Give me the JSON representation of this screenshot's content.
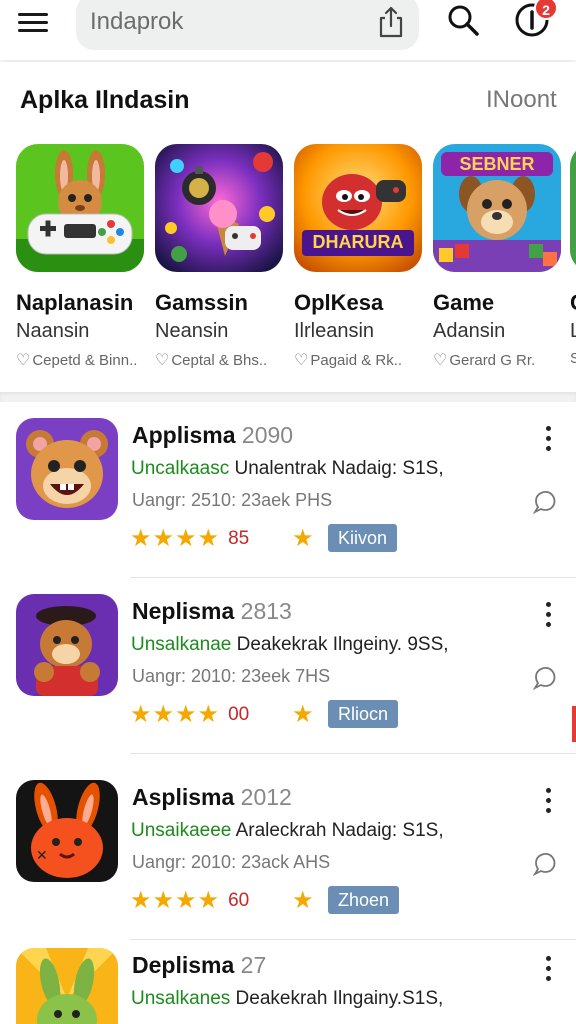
{
  "search": {
    "placeholder": "Indaprok"
  },
  "notifications": {
    "count": "2"
  },
  "featured": {
    "title": "Aplka Ilndasin",
    "more_label": "INoont",
    "cards": [
      {
        "title": "Naplanasin",
        "subtitle": "Naansin",
        "meta": "Cepetd & Binn..",
        "icon": "rabbit-controller-icon"
      },
      {
        "title": "Gamssin",
        "subtitle": "Neansin",
        "meta": "Ceptal & Bhs..",
        "icon": "bomb-ice-cream-icon"
      },
      {
        "title": "OplKesa",
        "subtitle": "Ilrleansin",
        "meta": "Pagaid & Rk..",
        "icon": "red-monster-icon",
        "art_text": "DHARURA"
      },
      {
        "title": "Game",
        "subtitle": "Adansin",
        "meta": "Gerard G Rr.",
        "icon": "puppy-puzzle-icon",
        "art_text": "SEBNER"
      },
      {
        "title": "C",
        "subtitle": "L",
        "meta": "S",
        "icon": "partial-card-icon"
      }
    ]
  },
  "apps": [
    {
      "title": "Applisma",
      "version": "2090",
      "line2_green": "Uncalkaasc",
      "line2_rest": " Unalentrak Nadaig: S1S,",
      "line3": "Uangr: 2510: 23aek  PHS",
      "rating": "85",
      "tag": "Kiivon",
      "icon": "hamster-icon"
    },
    {
      "title": "Neplisma",
      "version": "2813",
      "line2_green": "Unsalkanae",
      "line2_rest": " Deakekrak Ilngeiny. 9SS,",
      "line3": "Uangr: 2010: 23eek  7HS",
      "rating": "00",
      "tag": "Rliocn",
      "icon": "bear-character-icon"
    },
    {
      "title": "Asplisma",
      "version": "2012",
      "line2_green": "Unsaikaeee",
      "line2_rest": " Araleckrah Nadaig: S1S,",
      "line3": "Uangr: 2010: 23ack  AHS",
      "rating": "60",
      "tag": "Zhoen",
      "icon": "orange-bunny-icon"
    },
    {
      "title": "Deplisma",
      "version": "27",
      "line2_green": "Unsalkanes",
      "line2_rest": " Deakekrah Ilngainy.S1S,",
      "line3": "",
      "rating": "",
      "tag": "",
      "icon": "green-bunny-icon"
    }
  ],
  "colors": {
    "accent_green": "#1e8a1e",
    "rating_red": "#c62828",
    "star": "#f5a800",
    "tag_blue": "#6b8fb4",
    "badge_red": "#e53935"
  }
}
